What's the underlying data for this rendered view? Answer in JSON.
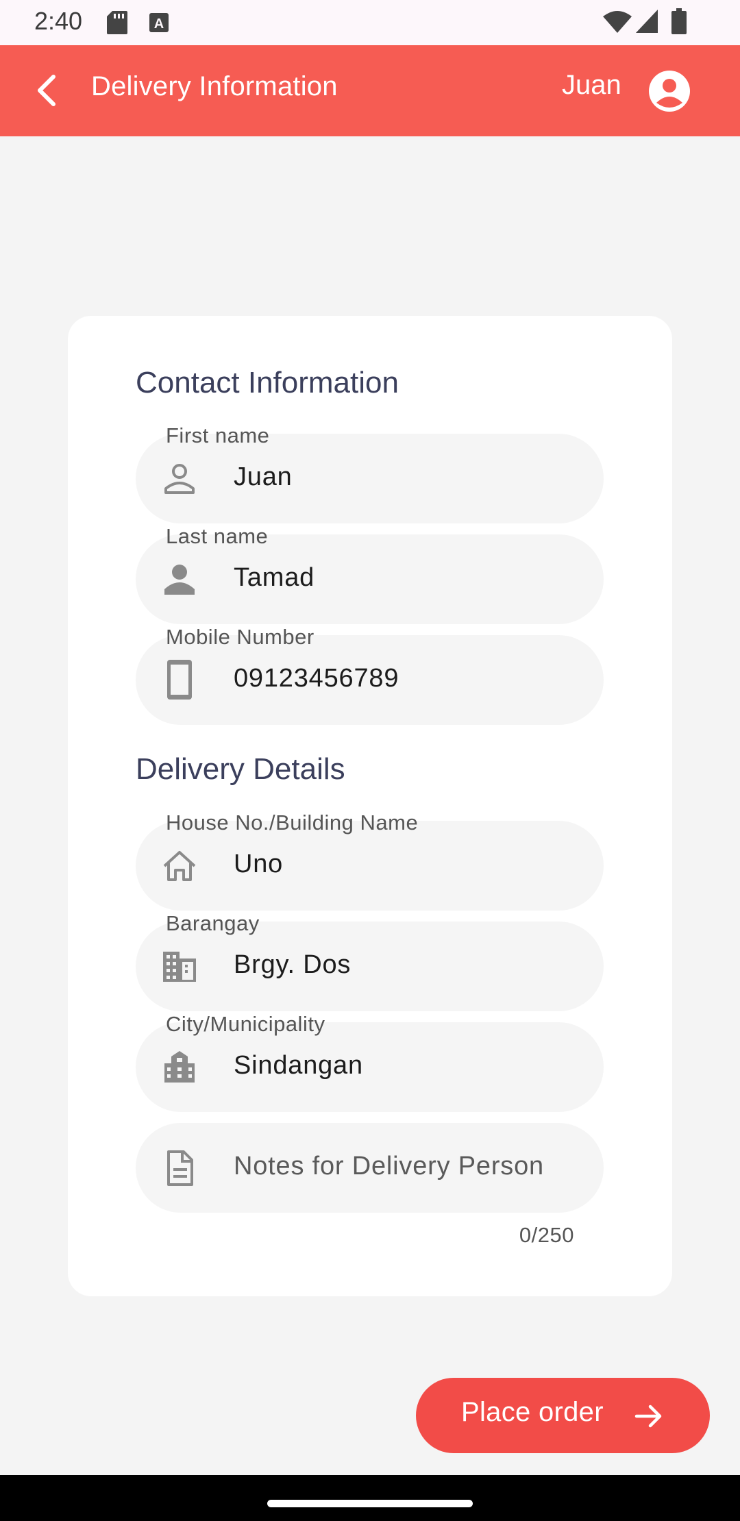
{
  "status_bar": {
    "time": "2:40",
    "icons": [
      "sd-card-icon",
      "text-a-icon",
      "wifi-icon",
      "signal-icon",
      "battery-icon"
    ]
  },
  "app_bar": {
    "title": "Delivery Information",
    "user_name": "Juan",
    "color": "#f65c53"
  },
  "contact": {
    "section_title": "Contact Information",
    "first_name": {
      "label": "First name",
      "value": "Juan",
      "icon": "person-outline-icon"
    },
    "last_name": {
      "label": "Last name",
      "value": "Tamad",
      "icon": "person-icon"
    },
    "mobile": {
      "label": "Mobile Number",
      "value": "09123456789",
      "icon": "phone-icon"
    }
  },
  "delivery": {
    "section_title": "Delivery Details",
    "house": {
      "label": "House No./Building Name",
      "value": "Uno",
      "icon": "home-icon"
    },
    "barangay": {
      "label": "Barangay",
      "value": "Brgy. Dos",
      "icon": "building-icon"
    },
    "city": {
      "label": "City/Municipality",
      "value": "Sindangan",
      "icon": "city-icon"
    },
    "notes": {
      "placeholder": "Notes for Delivery Person",
      "counter": "0/250",
      "icon": "document-icon"
    }
  },
  "actions": {
    "place_order_label": "Place order",
    "accent": "#f24c48"
  }
}
